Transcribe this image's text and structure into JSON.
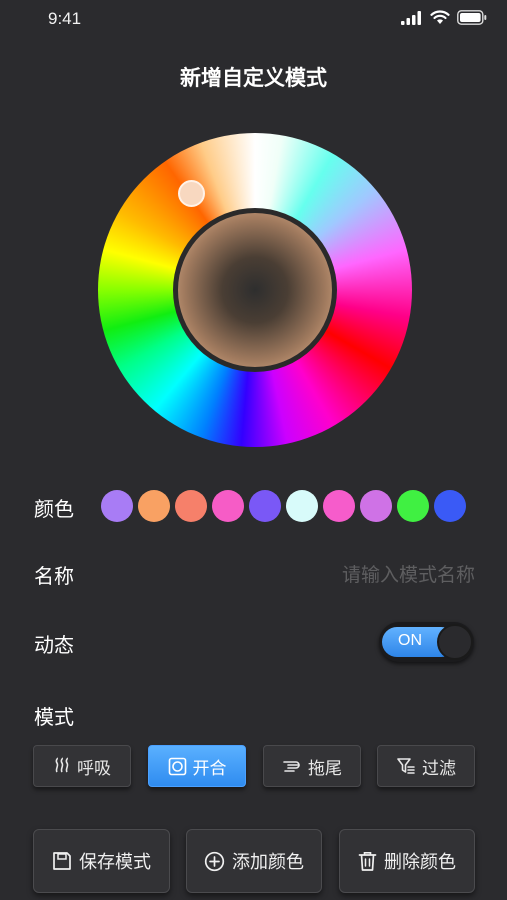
{
  "status_bar": {
    "time": "9:41"
  },
  "header": {
    "title": "新增自定义模式"
  },
  "color_picker": {
    "selected_color": "#f4c29a"
  },
  "colors_row": {
    "label": "颜色",
    "swatches": [
      "#a87cf5",
      "#f9a163",
      "#f6806a",
      "#f65cc6",
      "#7a58f6",
      "#d8fbfa",
      "#f65ccb",
      "#cf72e6",
      "#40f042",
      "#3a5af6"
    ]
  },
  "name_row": {
    "label": "名称",
    "placeholder": "请输入模式名称"
  },
  "dynamic_row": {
    "label": "动态",
    "toggle_label": "ON",
    "toggle_on": true
  },
  "mode_row": {
    "label": "模式",
    "options": [
      {
        "label": "呼吸",
        "icon": "breath-icon",
        "active": false
      },
      {
        "label": "开合",
        "icon": "open-close-icon",
        "active": true
      },
      {
        "label": "拖尾",
        "icon": "trail-icon",
        "active": false
      },
      {
        "label": "过滤",
        "icon": "filter-icon",
        "active": false
      }
    ]
  },
  "actions": {
    "save": {
      "label": "保存模式",
      "icon": "save-icon"
    },
    "add_color": {
      "label": "添加颜色",
      "icon": "add-circle-icon"
    },
    "delete_color": {
      "label": "删除颜色",
      "icon": "trash-icon"
    }
  },
  "theme": {
    "accent": "#3a8ef0",
    "background": "#2b2b2e"
  }
}
